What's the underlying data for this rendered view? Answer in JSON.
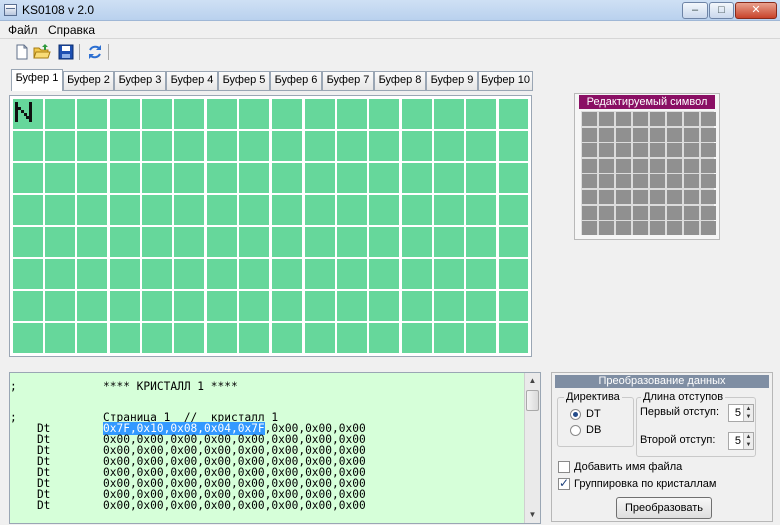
{
  "window": {
    "title": "KS0108 v 2.0"
  },
  "menu": {
    "items": [
      "Файл",
      "Справка"
    ]
  },
  "toolbar": {
    "icons": [
      "new-file-icon",
      "open-folder-icon",
      "save-icon",
      "refresh-icon"
    ]
  },
  "tabs": [
    {
      "label": "Буфер 1",
      "active": true
    },
    {
      "label": "Буфер 2"
    },
    {
      "label": "Буфер 3"
    },
    {
      "label": "Буфер 4"
    },
    {
      "label": "Буфер 5"
    },
    {
      "label": "Буфер 6"
    },
    {
      "label": "Буфер 7"
    },
    {
      "label": "Буфер 8"
    },
    {
      "label": "Буфер 9"
    },
    {
      "label": "Буфер 10"
    }
  ],
  "lcd": {
    "cell_color": "#66d79b",
    "glyph": "N-like character in first cell"
  },
  "symbol_editor": {
    "title": "Редактируемый символ",
    "cell_color": "#909090",
    "header_color": "#8a0f64"
  },
  "code": {
    "background": "#d6ffd9",
    "lines": [
      {
        "label": ";",
        "text": "**** КРИСТАЛЛ 1 ****"
      },
      {
        "label": "",
        "text": ""
      },
      {
        "label": ";",
        "text": "Страница 1  //  кристалл 1"
      },
      {
        "label": "    Dt",
        "text_hl": "0x7F,0x10,0x08,0x04,0x7F",
        "text_rest": ",0x00,0x00,0x00"
      },
      {
        "label": "    Dt",
        "text": "0x00,0x00,0x00,0x00,0x00,0x00,0x00,0x00"
      },
      {
        "label": "    Dt",
        "text": "0x00,0x00,0x00,0x00,0x00,0x00,0x00,0x00"
      },
      {
        "label": "    Dt",
        "text": "0x00,0x00,0x00,0x00,0x00,0x00,0x00,0x00"
      },
      {
        "label": "    Dt",
        "text": "0x00,0x00,0x00,0x00,0x00,0x00,0x00,0x00"
      },
      {
        "label": "    Dt",
        "text": "0x00,0x00,0x00,0x00,0x00,0x00,0x00,0x00"
      },
      {
        "label": "    Dt",
        "text": "0x00,0x00,0x00,0x00,0x00,0x00,0x00,0x00"
      },
      {
        "label": "    Dt",
        "text": "0x00,0x00,0x00,0x00,0x00,0x00,0x00,0x00"
      }
    ]
  },
  "conversion": {
    "title": "Преобразование данных",
    "directive_legend": "Директива",
    "directive_options": [
      {
        "label": "DT",
        "selected": true
      },
      {
        "label": "DB",
        "selected": false
      }
    ],
    "indent_legend": "Длина отступов",
    "first_indent_label": "Первый отступ:",
    "first_indent_value": "5",
    "second_indent_label": "Второй отступ:",
    "second_indent_value": "5",
    "add_filename_label": "Добавить имя файла",
    "add_filename_checked": false,
    "group_by_crystal_label": "Группировка по кристаллам",
    "group_by_crystal_checked": true,
    "convert_button": "Преобразовать"
  }
}
